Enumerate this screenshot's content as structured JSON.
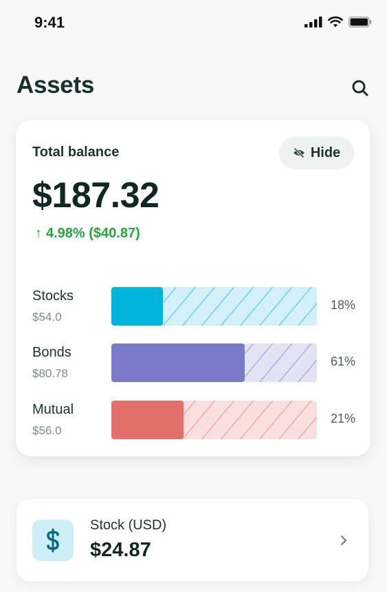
{
  "status_bar": {
    "time": "9:41",
    "icons": [
      "signal-icon",
      "wifi-icon",
      "battery-icon"
    ]
  },
  "header": {
    "title": "Assets",
    "search_icon": "search-icon"
  },
  "balance_card": {
    "label": "Total balance",
    "hide_label": "Hide",
    "hide_icon": "eye-off-icon",
    "amount": "$187.32",
    "change_arrow": "↑",
    "change_text": "4.98% ($40.87)",
    "change_color": "#23a73b"
  },
  "assets": [
    {
      "name": "Stocks",
      "value": "$54.0",
      "percent_label": "18%",
      "fill_fraction": 0.25,
      "color": "#00b4dd",
      "track_color": "#d3eff8",
      "hatch_color": "#6fd0ea"
    },
    {
      "name": "Bonds",
      "value": "$80.78",
      "percent_label": "61%",
      "fill_fraction": 0.65,
      "color": "#7b79c9",
      "track_color": "#e3e3f3",
      "hatch_color": "#b0aee0"
    },
    {
      "name": "Mutual",
      "value": "$56.0",
      "percent_label": "21%",
      "fill_fraction": 0.35,
      "color": "#e2706a",
      "track_color": "#f9e0df",
      "hatch_color": "#eeaaa6"
    }
  ],
  "stock_card": {
    "label": "Stock (USD)",
    "amount": "$24.87",
    "icon": "dollar-icon",
    "icon_color": "#0a6a86"
  }
}
